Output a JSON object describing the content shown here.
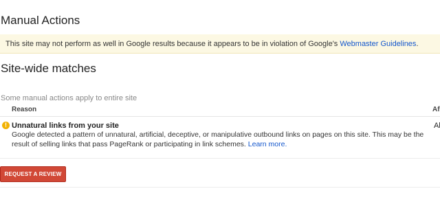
{
  "page": {
    "title": "Manual Actions"
  },
  "alert": {
    "text": "This site may not perform as well in Google results because it appears to be in violation of Google's ",
    "link_label": "Webmaster Guidelines",
    "end": "."
  },
  "site_wide": {
    "title": "Site-wide matches",
    "description": "Some manual actions apply to entire site",
    "columns": {
      "reason": "Reason",
      "affects": "Af"
    },
    "rows": [
      {
        "title": "Unnatural links from your site",
        "description": "Google detected a pattern of unnatural, artificial, deceptive, or manipulative outbound links on pages on this site. This may be the result of selling links that pass PageRank or participating in link schemes. ",
        "link_label": "Learn more.",
        "affects": "Al"
      }
    ]
  },
  "actions": {
    "review_button_label": "REQUEST A REVIEW"
  },
  "colors": {
    "alert_background": "#fcf8e3",
    "link": "#1155cc",
    "warning_icon": "#f2b202",
    "primary_button": "#d14836"
  },
  "icons": {
    "warning": "warning-icon"
  }
}
